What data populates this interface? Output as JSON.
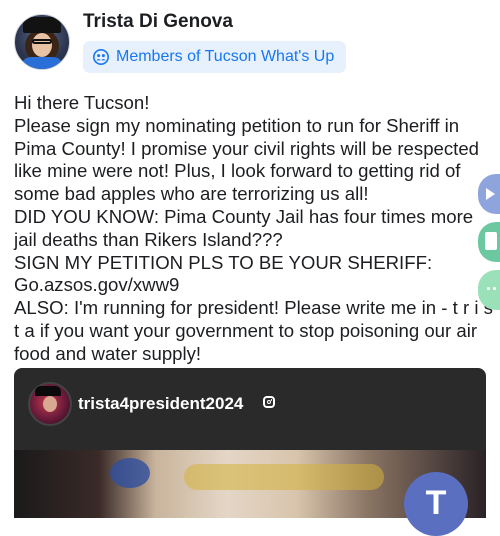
{
  "post": {
    "author": "Trista Di Genova",
    "group_label": "Members of Tucson What's Up",
    "text_lines": [
      "Hi there Tucson!",
      "Please sign my nominating petition to run for Sheriff in",
      "Pima County! I promise your civil rights will be respected",
      "like mine were not! Plus, I look forward to getting rid of",
      "some bad apples who are terrorizing us all!",
      "DID YOU KNOW: Pima County Jail has four times more",
      "jail deaths than Rikers Island???",
      "SIGN MY PETITION PLS TO BE YOUR SHERIFF:",
      "Go.azsos.gov/xww9",
      "ALSO: I'm running for president! Please write me in - t r i s",
      "t a if you want your government to stop poisoning our air",
      "food and water supply!"
    ]
  },
  "embed": {
    "handle": "trista4president2024",
    "platform_icon": "instagram-icon",
    "fab_letter": "T"
  },
  "side_actions": {
    "icons": [
      "share-icon",
      "book-icon",
      "chat-icon"
    ]
  },
  "colors": {
    "accent": "#1877f2",
    "badge_bg": "#e7f0fd",
    "embed_bg": "#2a2a2a",
    "fab": "#5a6fc0"
  }
}
